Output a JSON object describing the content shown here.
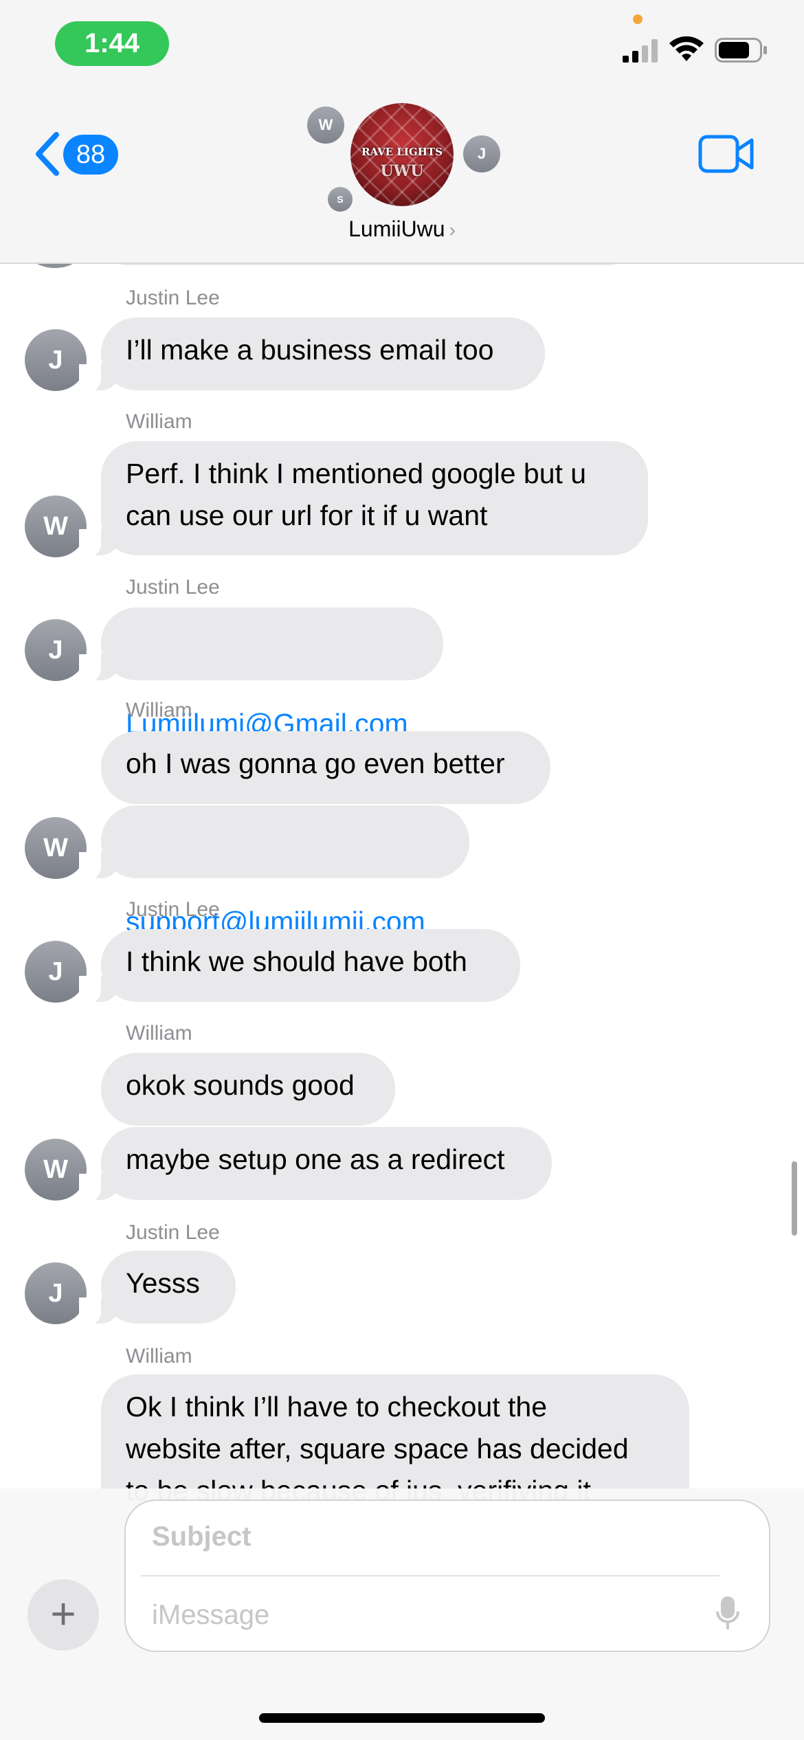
{
  "status_bar": {
    "time": "1:44"
  },
  "header": {
    "back_count": "88",
    "group_name": "LumiiUwu",
    "group_logo_line1": "RAVE LIGHTS",
    "group_logo_line2": "UWU",
    "member_initials": [
      "W",
      "J",
      "S"
    ]
  },
  "messages": [
    {
      "sender": "Justin Lee",
      "initial": "J",
      "text": "I’ll make a business email too"
    },
    {
      "sender": "William",
      "initial": "W",
      "text": "Perf. I think I mentioned google but u\ncan use our url for it if u want"
    },
    {
      "sender": "Justin Lee",
      "initial": "J",
      "text": "Lumiilumi@Gmail.com"
    },
    {
      "sender": "William",
      "initial": "W",
      "text_1": "oh I was gonna go even better",
      "text_2": "support@lumiilumii.com"
    },
    {
      "sender": "Justin Lee",
      "initial": "J",
      "text": "I think we should have both"
    },
    {
      "sender": "William",
      "initial": "W",
      "text_1": "okok sounds good",
      "text_2": "maybe setup one as a redirect"
    },
    {
      "sender": "Justin Lee",
      "initial": "J",
      "text": "Yesss"
    },
    {
      "sender": "William",
      "text": "Ok I think I’ll have to checkout the\nwebsite after, square space has decided\nto be slow because of jus  verifiying it"
    }
  ],
  "composer": {
    "subject_placeholder": "Subject",
    "message_placeholder": "iMessage",
    "plus_label": "+"
  }
}
